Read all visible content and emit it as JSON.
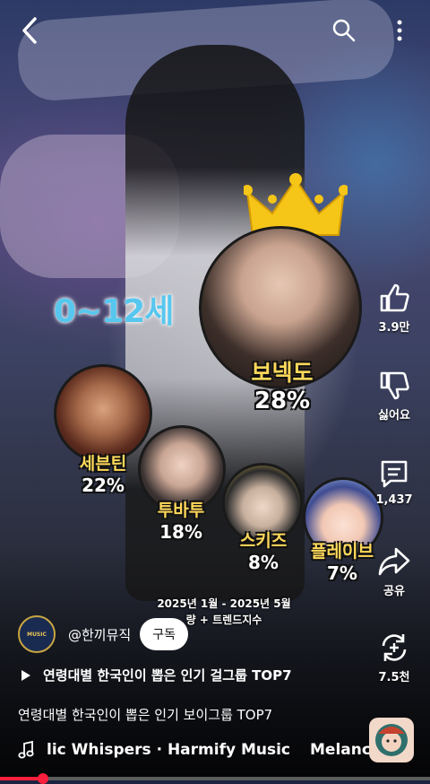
{
  "topbar": {
    "back_icon": "chevron-left-icon",
    "search_icon": "search-icon",
    "more_icon": "more-vertical-icon"
  },
  "chart_data": {
    "type": "bar",
    "title": "0~12세",
    "categories": [
      "보넥도",
      "세븐틴",
      "투바투",
      "스키즈",
      "플레이브"
    ],
    "values": [
      28,
      22,
      18,
      8,
      7
    ],
    "labels": [
      "28%",
      "22%",
      "18%",
      "8%",
      "7%"
    ]
  },
  "overlay": {
    "age_group": "0~12세",
    "caption_line1": "2025년 1월 - 2025년 5월",
    "caption_line2": "량 + 트렌드지수"
  },
  "actions": {
    "like_count": "3.9만",
    "dislike_label": "싫어요",
    "comment_count": "1,437",
    "share_label": "공유",
    "remix_count": "7.5천"
  },
  "channel": {
    "avatar_text": "MUSIC",
    "name": "@한끼뮤직",
    "subscribe_label": "구독"
  },
  "playlist_label": "연령대별 한국인이 뽑은 인기 걸그룹 TOP7",
  "video_title": "연령대별 한국인이 뽑은 인기 보이그룹 TOP7",
  "music": {
    "text1": "lic Whispers · Harmify Music",
    "text2": "Melanc"
  },
  "progress": {
    "fraction": 0.1
  },
  "colors": {
    "accent_red": "#ff1e3c",
    "age_blue": "#57c7ee",
    "name_yellow": "#ffd95a",
    "crown_gold": "#f5c518"
  }
}
